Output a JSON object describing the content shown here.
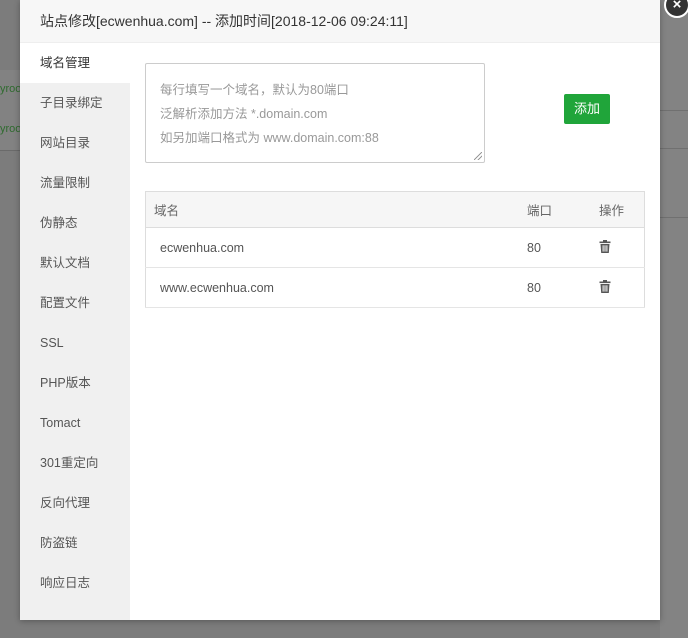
{
  "dialog": {
    "title": "站点修改[ecwenhua.com] -- 添加时间[2018-12-06 09:24:11]",
    "close": "×"
  },
  "sidebar": {
    "items": [
      {
        "label": "域名管理",
        "active": true
      },
      {
        "label": "子目录绑定"
      },
      {
        "label": "网站目录"
      },
      {
        "label": "流量限制"
      },
      {
        "label": "伪静态"
      },
      {
        "label": "默认文档"
      },
      {
        "label": "配置文件"
      },
      {
        "label": "SSL"
      },
      {
        "label": "PHP版本"
      },
      {
        "label": "Tomact"
      },
      {
        "label": "301重定向"
      },
      {
        "label": "反向代理"
      },
      {
        "label": "防盗链"
      },
      {
        "label": "响应日志"
      }
    ]
  },
  "domain_input": {
    "placeholder_lines": [
      "每行填写一个域名，默认为80端口",
      "泛解析添加方法 *.domain.com",
      "如另加端口格式为 www.domain.com:88"
    ]
  },
  "add_button": {
    "label": "添加"
  },
  "table": {
    "headers": {
      "domain": "域名",
      "port": "端口",
      "action": "操作"
    },
    "rows": [
      {
        "domain": "ecwenhua.com",
        "port": "80"
      },
      {
        "domain": "www.ecwenhua.com",
        "port": "80"
      }
    ]
  },
  "background": {
    "row_texts": [
      "yroo",
      "yroo"
    ]
  },
  "colors": {
    "accent": "#20a53a",
    "overlay": "#7c7c7c",
    "sidebar": "#f0f0f0"
  }
}
